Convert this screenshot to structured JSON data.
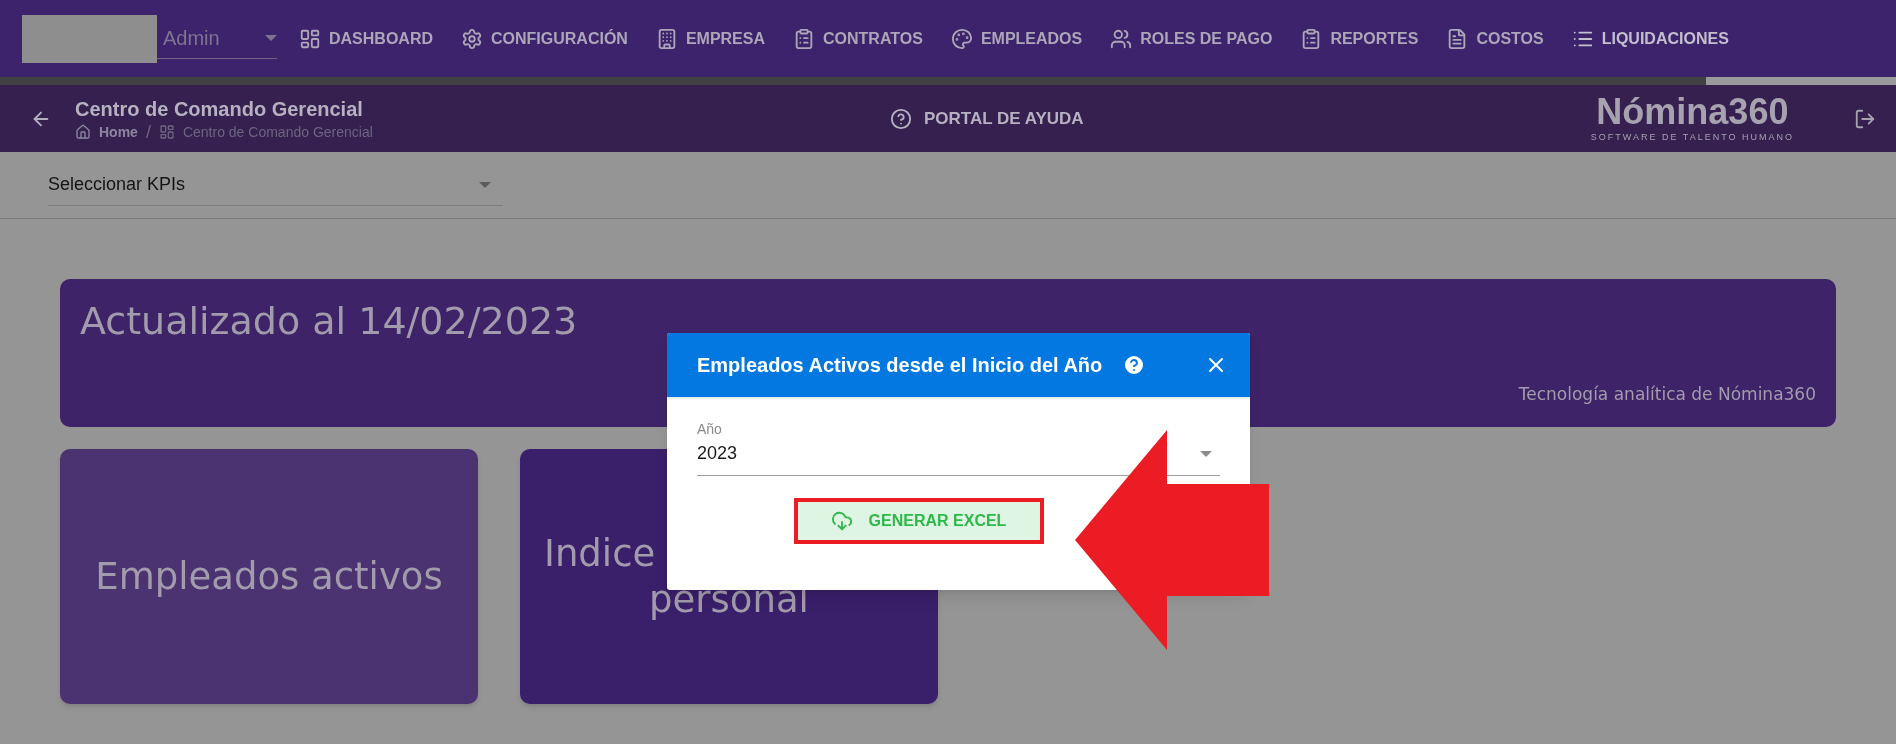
{
  "top_nav": {
    "user_select": {
      "value": "Admin"
    },
    "items": [
      {
        "label": "DASHBOARD",
        "selected": false
      },
      {
        "label": "CONFIGURACIÓN",
        "selected": false
      },
      {
        "label": "EMPRESA",
        "selected": false
      },
      {
        "label": "CONTRATOS",
        "selected": false
      },
      {
        "label": "EMPLEADOS",
        "selected": false
      },
      {
        "label": "ROLES DE PAGO",
        "selected": false
      },
      {
        "label": "REPORTES",
        "selected": false
      },
      {
        "label": "COSTOS",
        "selected": false
      },
      {
        "label": "LIQUIDACIONES",
        "selected": true
      }
    ]
  },
  "header": {
    "title": "Centro de Comando Gerencial",
    "breadcrumb": [
      "Home",
      "Centro de Comando Gerencial"
    ],
    "breadcrumb_separator": "/",
    "help_link": "PORTAL DE AYUDA",
    "logo": {
      "name": "Nómina360",
      "tagline": "SOFTWARE DE TALENTO HUMANO"
    }
  },
  "kpi_select": {
    "value": "Seleccionar KPIs"
  },
  "banner": {
    "title": "Actualizado al 14/02/2023",
    "footer": "Tecnología analítica de Nómina360"
  },
  "cards": [
    {
      "lines": [
        "Empleados activos"
      ],
      "highlighted": true
    },
    {
      "lines": [
        "Indice",
        "personal"
      ],
      "highlighted": false
    }
  ],
  "dialog": {
    "title": "Empleados Activos desde el Inicio del Año",
    "field": {
      "label": "Año",
      "value": "2023"
    },
    "button": "GENERAR EXCEL"
  }
}
